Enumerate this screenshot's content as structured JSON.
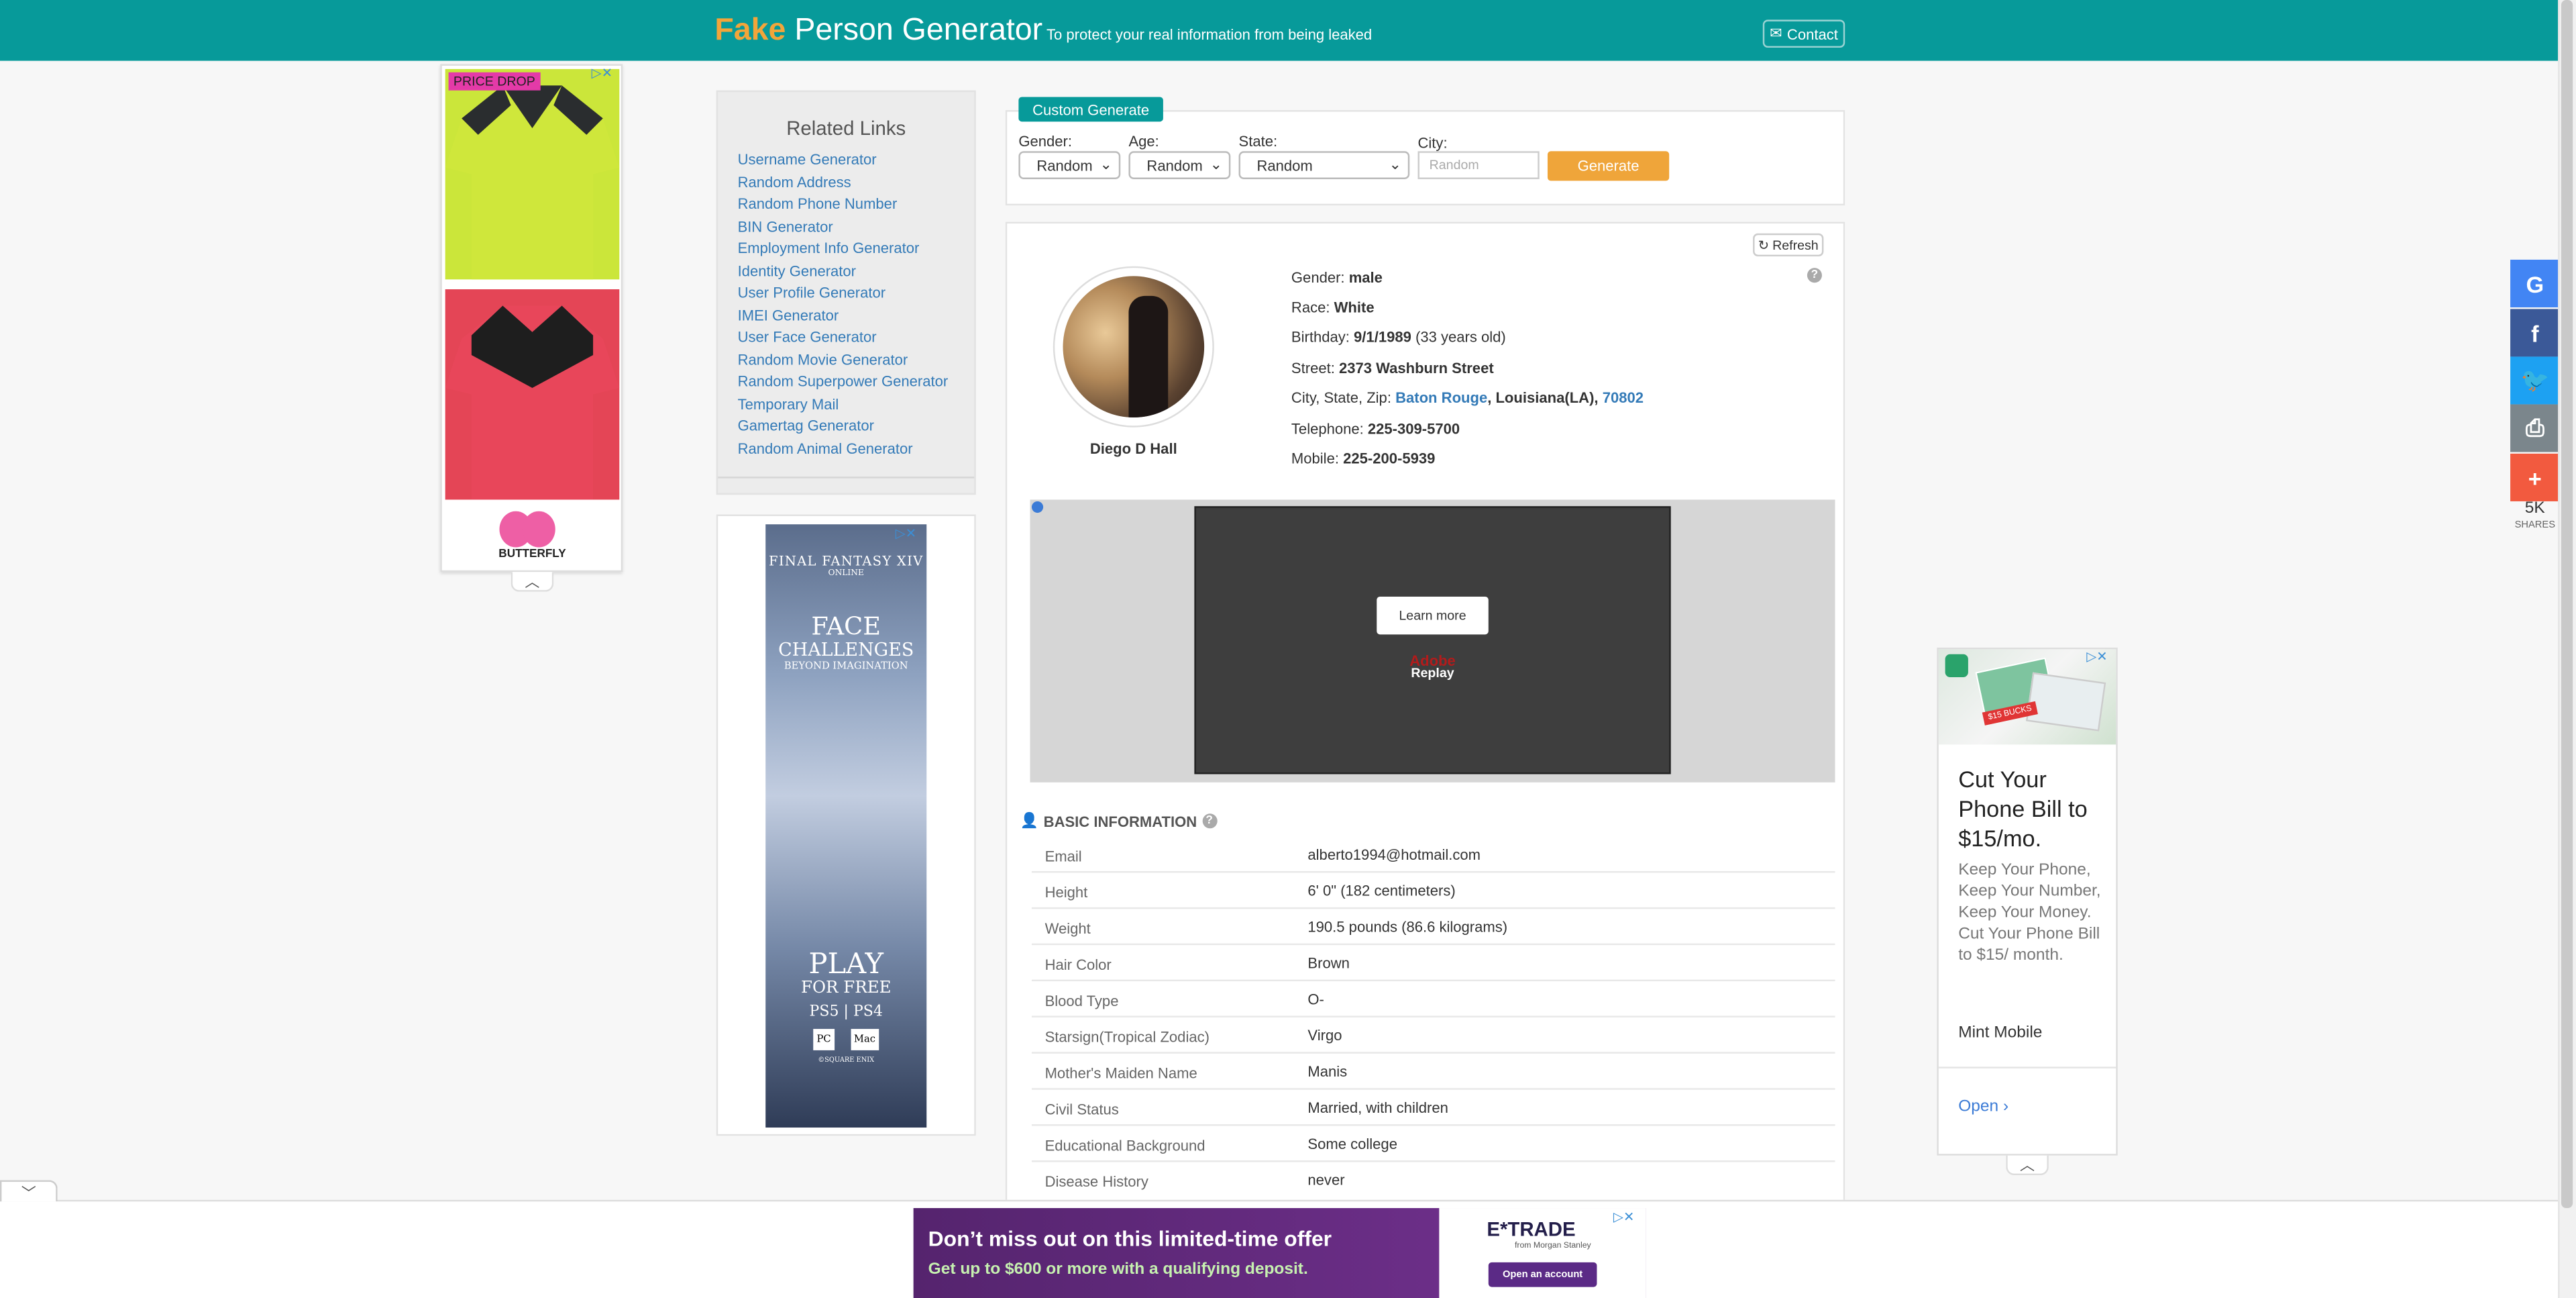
{
  "header": {
    "logo_fake": "Fake",
    "logo_rest": " Person Generator",
    "tagline": "To protect your real information from being leaked",
    "contact_label": "Contact"
  },
  "left_ad": {
    "badge": "PRICE DROP",
    "brand": "BUTTERFLY",
    "ad_marks": "▷✕"
  },
  "related": {
    "title": "Related Links",
    "items": [
      "Username Generator",
      "Random Address",
      "Random Phone Number",
      "BIN Generator",
      "Employment Info Generator",
      "Identity Generator",
      "User Profile Generator",
      "IMEI Generator",
      "User Face Generator",
      "Random Movie Generator",
      "Random Superpower Generator",
      "Temporary Mail",
      "Gamertag Generator",
      "Random Animal Generator"
    ]
  },
  "ff_ad": {
    "logo": "FINAL FANTASY XIV",
    "sub": "ONLINE",
    "face": "FACE",
    "challenges": "CHALLENGES",
    "beyond": "BEYOND IMAGINATION",
    "play": "PLAY",
    "forfree": "FOR FREE",
    "platforms": "PS5 | PS4",
    "pc": "PC",
    "mac": "Mac",
    "copyright": "©SQUARE ENIX"
  },
  "custom": {
    "tab_label": "Custom Generate",
    "gender_label": "Gender:",
    "gender_value": "Random",
    "age_label": "Age:",
    "age_value": "Random",
    "state_label": "State:",
    "state_value": "Random",
    "city_label": "City:",
    "city_placeholder": "Random",
    "generate_label": "Generate"
  },
  "profile": {
    "refresh_label": "Refresh",
    "name": "Diego D Hall",
    "gender_label": "Gender: ",
    "gender": "male",
    "race_label": "Race: ",
    "race": "White",
    "birthday_label": "Birthday: ",
    "birthday": "9/1/1989",
    "age_note": " (33 years old)",
    "street_label": "Street: ",
    "street": "2373 Washburn Street",
    "csz_label": "City, State, Zip: ",
    "city": "Baton Rouge",
    "state": ", Louisiana(LA), ",
    "zip": "70802",
    "telephone_label": "Telephone: ",
    "telephone": "225-309-5700",
    "mobile_label": "Mobile: ",
    "mobile": "225-200-5939"
  },
  "video_ad": {
    "learn_more": "Learn more",
    "adobe": "Adobe",
    "replay": "Replay"
  },
  "basic": {
    "title": "BASIC INFORMATION",
    "rows": [
      {
        "label": "Email",
        "value": "alberto1994@hotmail.com"
      },
      {
        "label": "Height",
        "value": "6' 0\" (182 centimeters)"
      },
      {
        "label": "Weight",
        "value": "190.5 pounds (86.6 kilograms)"
      },
      {
        "label": "Hair Color",
        "value": "Brown"
      },
      {
        "label": "Blood Type",
        "value": "O-"
      },
      {
        "label": "Starsign(Tropical Zodiac)",
        "value": "Virgo"
      },
      {
        "label": "Mother's Maiden Name",
        "value": "Manis"
      },
      {
        "label": "Civil Status",
        "value": "Married, with children"
      },
      {
        "label": "Educational Background",
        "value": "Some college"
      },
      {
        "label": "Disease History",
        "value": "never"
      }
    ]
  },
  "social": {
    "share_count": "5K",
    "share_label": "SHARES",
    "colors": {
      "google": "#4285f4",
      "facebook": "#3b5998",
      "twitter": "#1da1f2",
      "print": "#7b868c",
      "more": "#f25a3f"
    }
  },
  "right_ad": {
    "promo": "$15 BUCKS",
    "title": "Cut Your Phone Bill to $15/mo.",
    "body": "Keep Your Phone, Keep Your Number, Keep Your Money. Cut Your Phone Bill to $15/ month.",
    "brand": "Mint Mobile",
    "open": "Open"
  },
  "bottom_ad": {
    "headline": "Don’t miss out on this limited-time offer",
    "subline": "Get up to $600 or more with a qualifying deposit.",
    "logo": "E*TRADE",
    "logo_sub": "from Morgan Stanley",
    "button": "Open an account"
  },
  "theme": {
    "header_bg": "#079a9a",
    "accent_orange": "#efa53a",
    "link": "#337ab7"
  }
}
